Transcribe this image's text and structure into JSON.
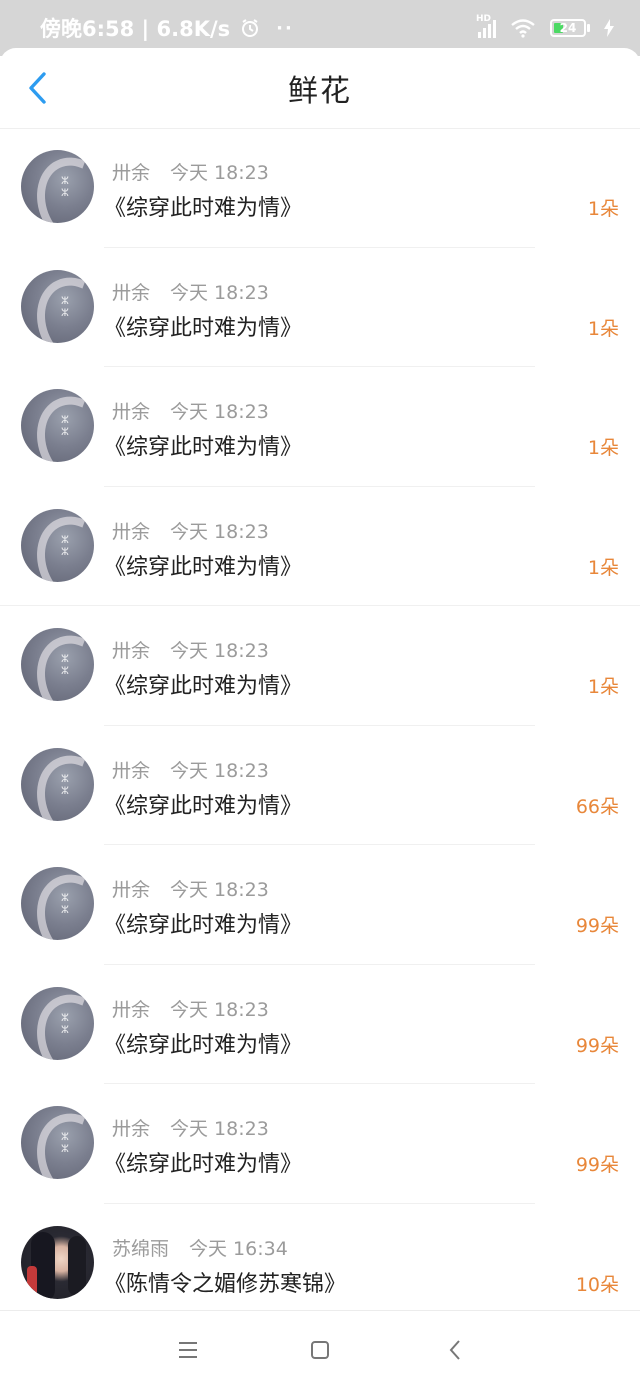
{
  "status_bar": {
    "time_text": "傍晚6:58 | 6.8K/s",
    "dots": "··",
    "network": "HD",
    "battery": "24",
    "icons": [
      "alarm-icon",
      "signal-icon",
      "wifi-icon",
      "battery-icon",
      "charging-icon"
    ]
  },
  "header": {
    "title": "鲜花",
    "back_icon": "chevron-left-icon"
  },
  "records": [
    {
      "user": "卅余",
      "time": "今天 18:23",
      "book": "《综穿此时难为情》",
      "count": "1朵",
      "avatar": "scene"
    },
    {
      "user": "卅余",
      "time": "今天 18:23",
      "book": "《综穿此时难为情》",
      "count": "1朵",
      "avatar": "scene"
    },
    {
      "user": "卅余",
      "time": "今天 18:23",
      "book": "《综穿此时难为情》",
      "count": "1朵",
      "avatar": "scene"
    },
    {
      "user": "卅余",
      "time": "今天 18:23",
      "book": "《综穿此时难为情》",
      "count": "1朵",
      "avatar": "scene"
    },
    {
      "user": "卅余",
      "time": "今天 18:23",
      "book": "《综穿此时难为情》",
      "count": "1朵",
      "avatar": "scene"
    },
    {
      "user": "卅余",
      "time": "今天 18:23",
      "book": "《综穿此时难为情》",
      "count": "66朵",
      "avatar": "scene"
    },
    {
      "user": "卅余",
      "time": "今天 18:23",
      "book": "《综穿此时难为情》",
      "count": "99朵",
      "avatar": "scene"
    },
    {
      "user": "卅余",
      "time": "今天 18:23",
      "book": "《综穿此时难为情》",
      "count": "99朵",
      "avatar": "scene"
    },
    {
      "user": "卅余",
      "time": "今天 18:23",
      "book": "《综穿此时难为情》",
      "count": "99朵",
      "avatar": "scene"
    },
    {
      "user": "苏绵雨",
      "time": "今天 16:34",
      "book": "《陈情令之媚修苏寒锦》",
      "count": "10朵",
      "avatar": "girl"
    }
  ],
  "nav_bar": {
    "icons": [
      "menu-icon",
      "home-square-icon",
      "back-triangle-icon"
    ]
  },
  "colors": {
    "accent_count": "#e8873a",
    "back_arrow": "#2d9cf0",
    "status_bar_bg": "#d6d6d6"
  }
}
